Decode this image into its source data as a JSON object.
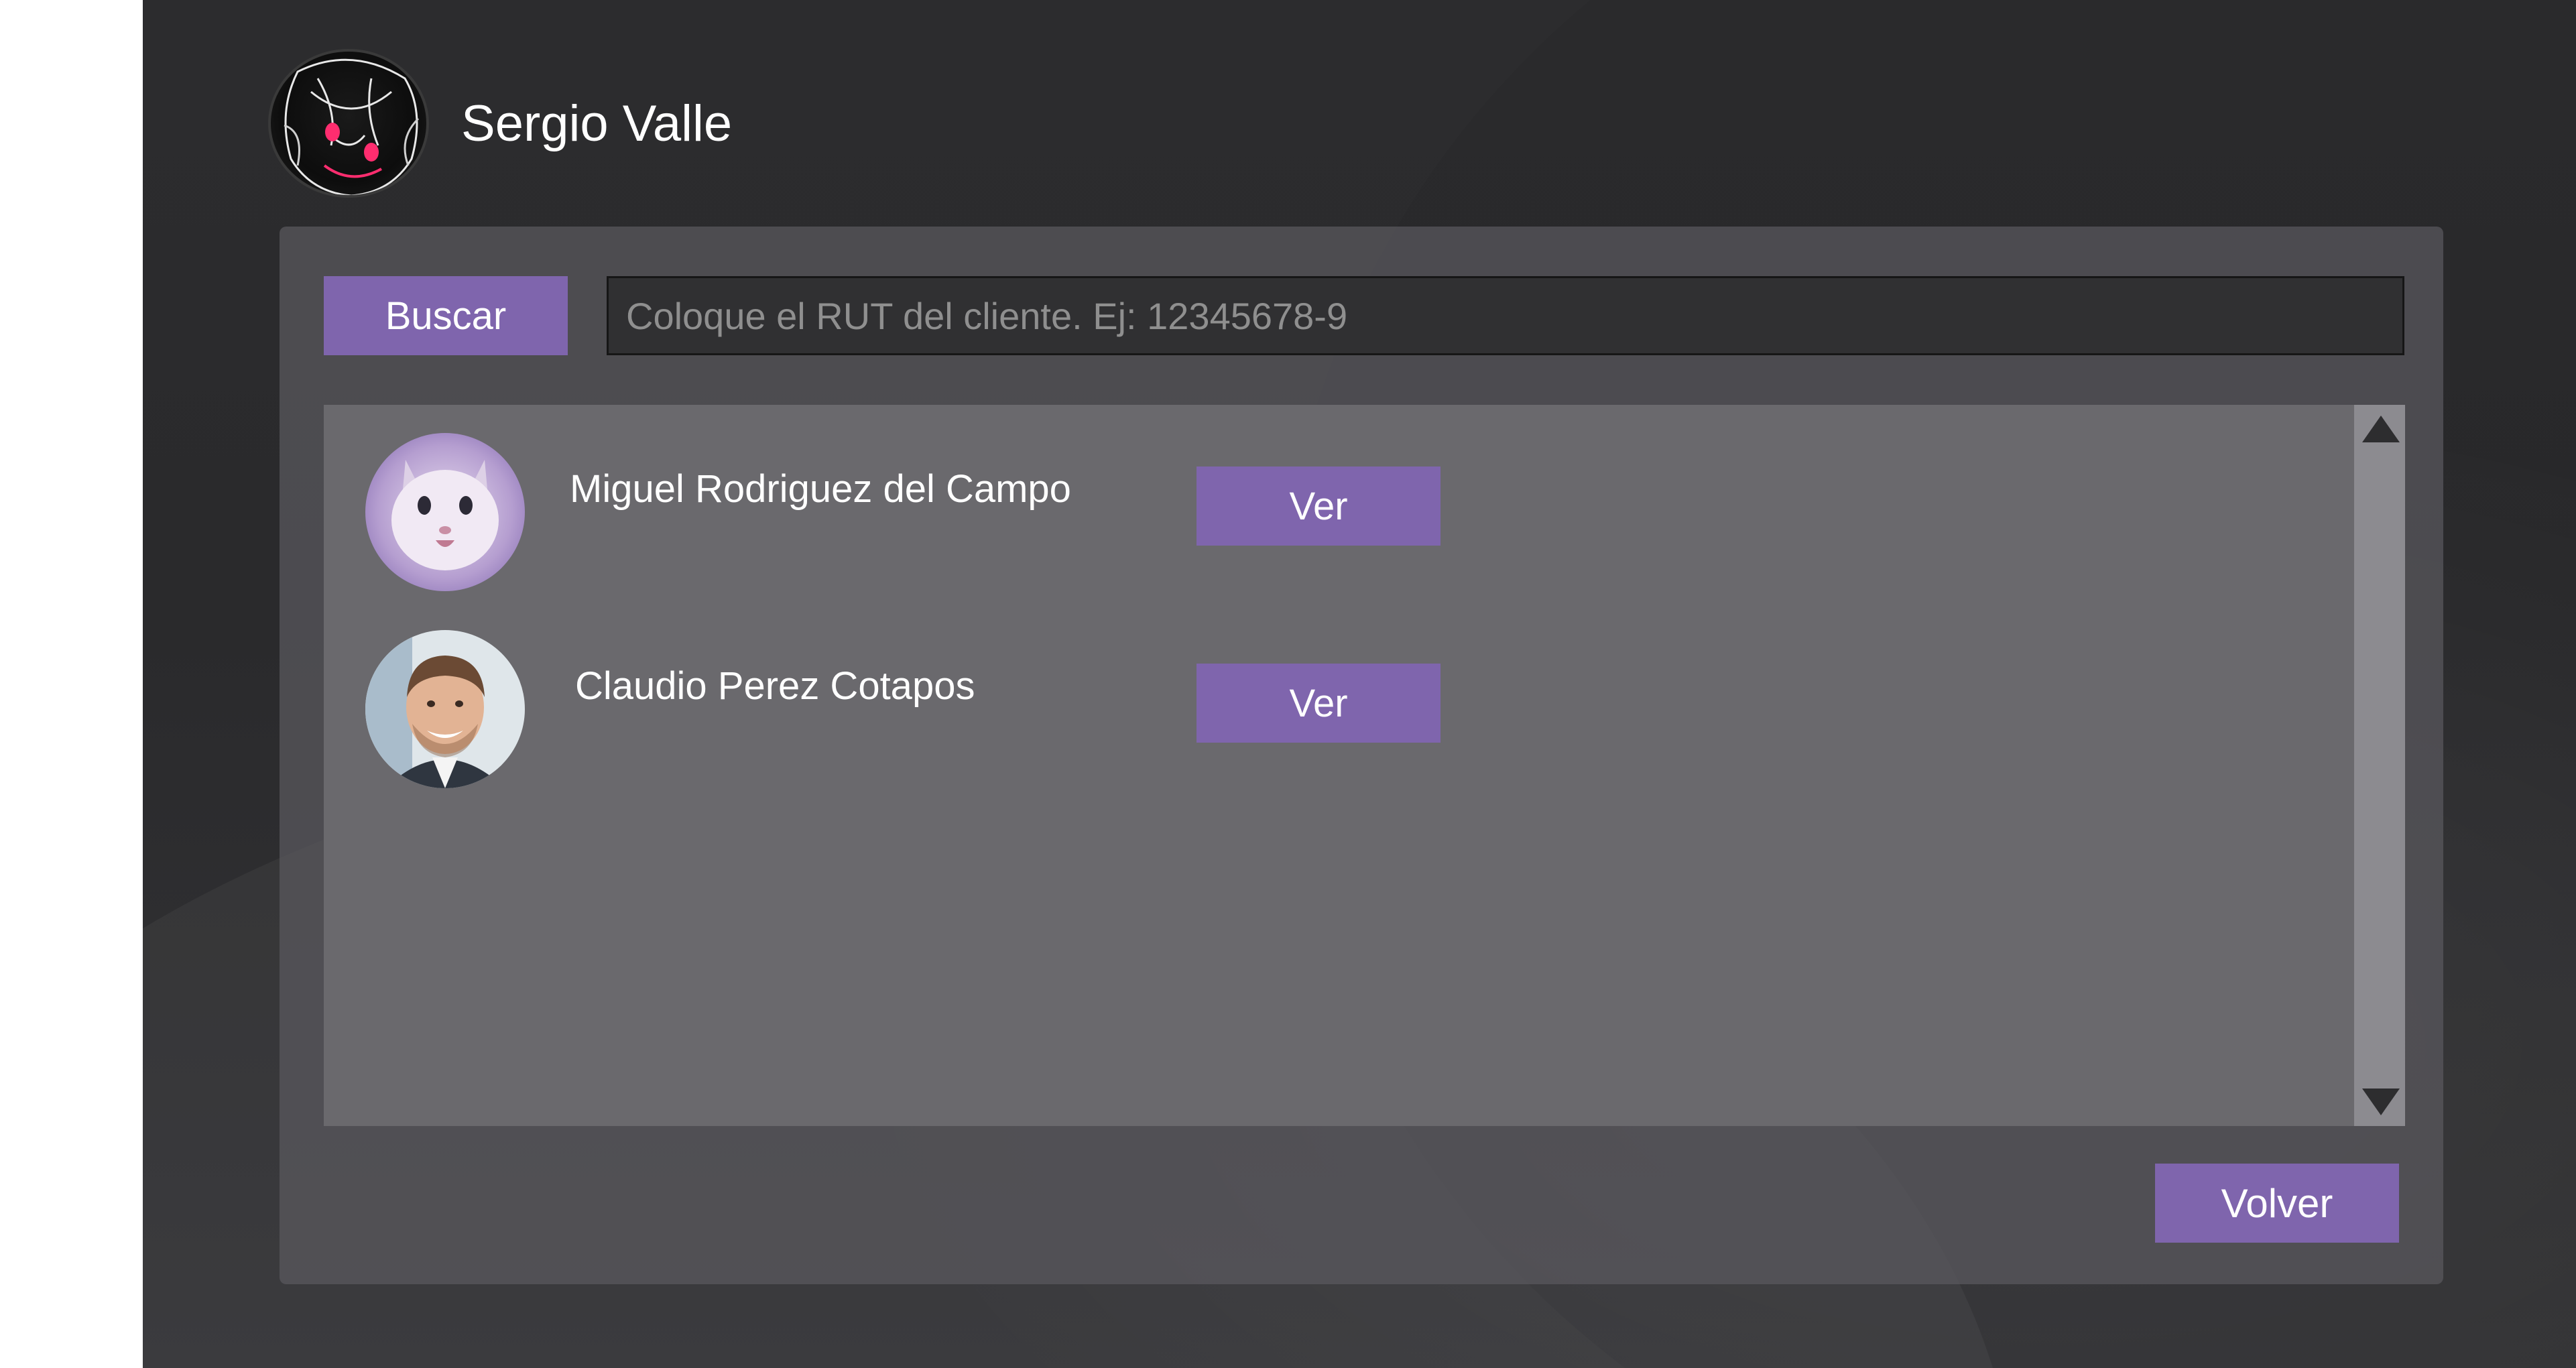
{
  "header": {
    "user_name": "Sergio Valle",
    "avatar_icon": "anime-avatar"
  },
  "search": {
    "button_label": "Buscar",
    "placeholder": "Coloque el RUT del cliente. Ej: 12345678-9",
    "value": ""
  },
  "clients": [
    {
      "name": "Miguel Rodriguez del Campo",
      "action_label": "Ver",
      "avatar_icon": "cat-photo"
    },
    {
      "name": "Claudio Perez Cotapos",
      "action_label": "Ver",
      "avatar_icon": "man-photo"
    }
  ],
  "footer": {
    "back_label": "Volver"
  },
  "colors": {
    "accent": "#7f65ad",
    "background": "#2c2c2e",
    "panel": "#5a595e",
    "list": "#6a696d"
  }
}
